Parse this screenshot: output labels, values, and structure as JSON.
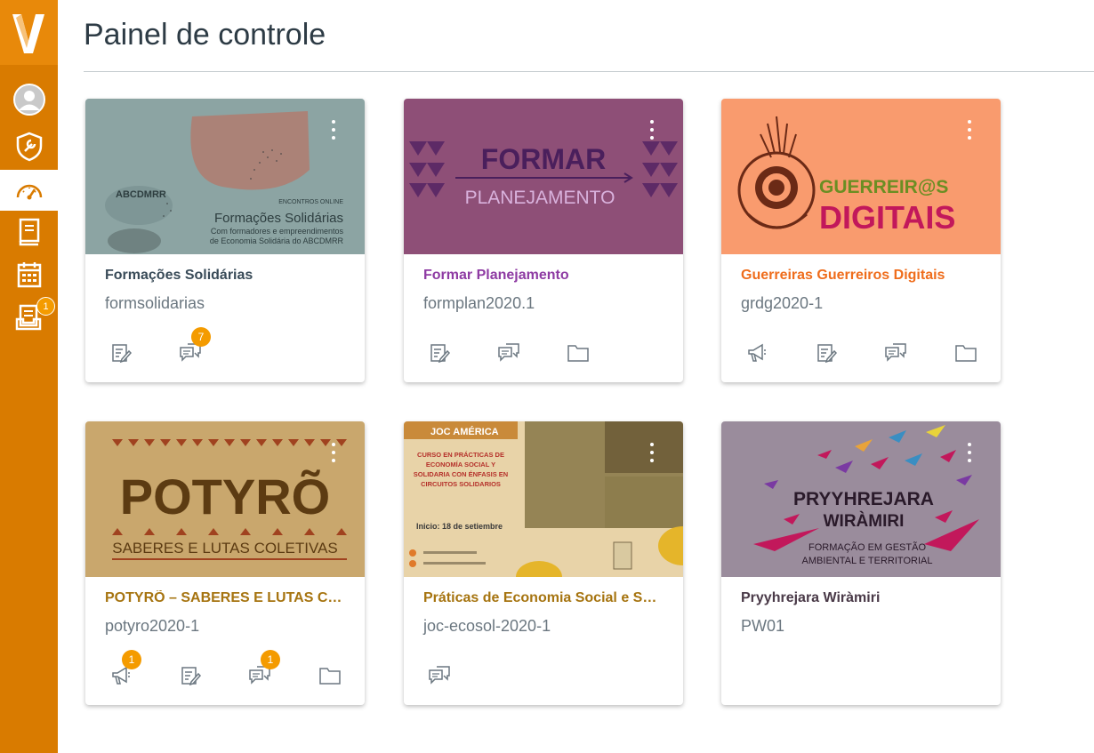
{
  "page": {
    "title": "Painel de controle"
  },
  "nav": {
    "items": [
      {
        "name": "account",
        "icon": "avatar-icon",
        "badge": ""
      },
      {
        "name": "admin",
        "icon": "shield-wrench-icon",
        "badge": ""
      },
      {
        "name": "dashboard",
        "icon": "speedometer-icon",
        "badge": ""
      },
      {
        "name": "courses",
        "icon": "book-icon",
        "badge": ""
      },
      {
        "name": "calendar",
        "icon": "calendar-icon",
        "badge": ""
      },
      {
        "name": "inbox",
        "icon": "inbox-icon",
        "badge": "1"
      }
    ]
  },
  "cards": [
    {
      "title": "Formações Solidárias",
      "code": "formsolidarias",
      "color": "#394b58",
      "image_text": {
        "brand": "ABCDMRR",
        "kicker": "ENCONTROS ONLINE",
        "headline": "Formações Solidárias",
        "sub1": "Com formadores e empreendimentos",
        "sub2": "de Economia Solidária do ABCDMRR"
      },
      "icons": [
        {
          "name": "assignments-icon",
          "badge": ""
        },
        {
          "name": "discussions-icon",
          "badge": "7"
        }
      ]
    },
    {
      "title": "Formar Planejamento",
      "code": "formplan2020.1",
      "color": "#8e3ba3",
      "image_text": {
        "line1": "FORMAR",
        "line2": "PLANEJAMENTO"
      },
      "icons": [
        {
          "name": "assignments-icon",
          "badge": ""
        },
        {
          "name": "discussions-icon",
          "badge": ""
        },
        {
          "name": "files-icon",
          "badge": ""
        }
      ]
    },
    {
      "title": "Guerreiras Guerreiros Digitais",
      "code": "grdg2020-1",
      "color": "#ef6d1c",
      "image_text": {
        "line1": "GUERREIR@S",
        "line2": "DIGITAIS"
      },
      "icons": [
        {
          "name": "announcements-icon",
          "badge": ""
        },
        {
          "name": "assignments-icon",
          "badge": ""
        },
        {
          "name": "discussions-icon",
          "badge": ""
        },
        {
          "name": "files-icon",
          "badge": ""
        }
      ]
    },
    {
      "title": "POTYRÕ – SABERES E LUTAS COLETIVAS",
      "code": "potyro2020-1",
      "color": "#a67410",
      "image_text": {
        "line1": "POTYRÕ",
        "line2": "SABERES E LUTAS COLETIVAS"
      },
      "icons": [
        {
          "name": "announcements-icon",
          "badge": "1"
        },
        {
          "name": "assignments-icon",
          "badge": ""
        },
        {
          "name": "discussions-icon",
          "badge": "1"
        },
        {
          "name": "files-icon",
          "badge": ""
        }
      ]
    },
    {
      "title": "Práticas de Economia Social e Solidária",
      "code": "joc-ecosol-2020-1",
      "color": "#a67410",
      "image_text": {
        "org": "JOC AMÉRICA",
        "l1": "CURSO EN PRÁCTICAS DE",
        "l2": "ECONOMÍA SOCIAL Y",
        "l3": "SOLIDARIA CON ÉNFASIS EN",
        "l4": "CIRCUITOS SOLIDARIOS",
        "start": "Inicio:  18 de setiembre"
      },
      "icons": [
        {
          "name": "discussions-icon",
          "badge": ""
        }
      ]
    },
    {
      "title": "Pryyhrejara Wiràmiri",
      "code": "PW01",
      "color": "#4a3a48",
      "image_text": {
        "line1": "PRYYHREJARA",
        "line2": "WIRÀMIRI",
        "sub1": "FORMAÇÃO EM GESTÃO",
        "sub2": "AMBIENTAL E TERRITORIAL"
      },
      "icons": []
    }
  ]
}
